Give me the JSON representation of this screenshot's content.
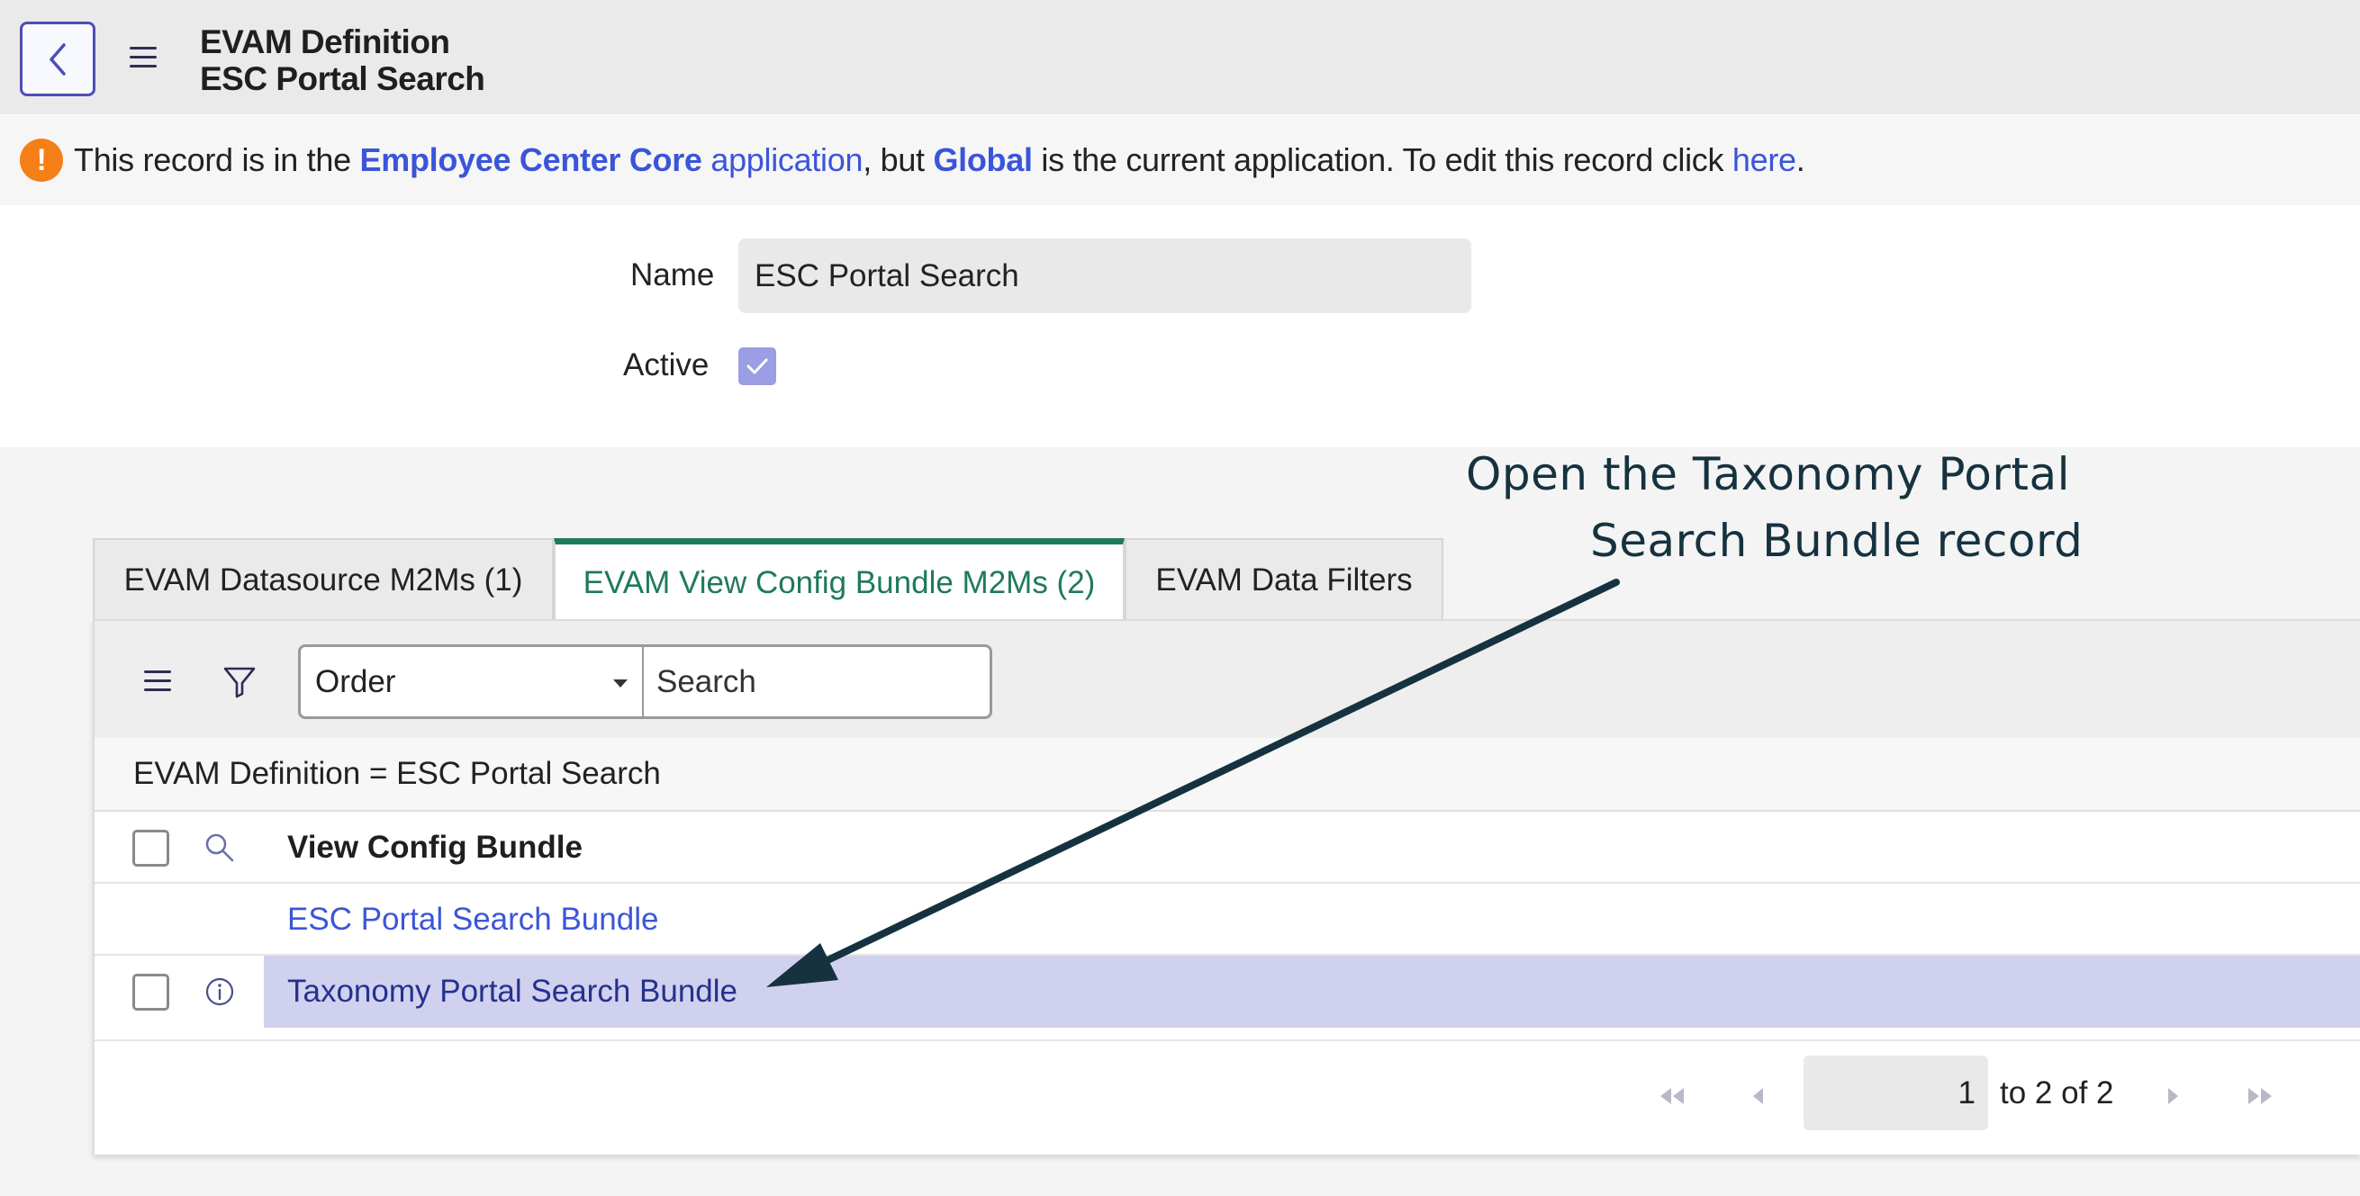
{
  "header": {
    "title_line1": "EVAM Definition",
    "title_line2": "ESC Portal Search",
    "back_icon": "chevron-left-icon",
    "menu_icon": "hamburger-icon"
  },
  "notice": {
    "icon": "exclamation-icon",
    "part1": "This record is in the",
    "app_bold": "Employee Center Core",
    "app_word": "application",
    "part2": ", but",
    "global": "Global",
    "part3": "is the current application. To edit this record click",
    "here": "here",
    "period": "."
  },
  "form": {
    "name_label": "Name",
    "name_value": "ESC Portal Search",
    "active_label": "Active",
    "active_checked": true
  },
  "tabs": [
    {
      "label": "EVAM Datasource M2Ms (1)",
      "active": false
    },
    {
      "label": "EVAM View Config Bundle M2Ms (2)",
      "active": true
    },
    {
      "label": "EVAM Data Filters",
      "active": false
    }
  ],
  "list": {
    "order_select": "Order",
    "search_placeholder": "Search",
    "breadcrumb": "EVAM Definition = ESC Portal Search",
    "column_header": "View Config Bundle",
    "rows": [
      {
        "label": "ESC Portal Search Bundle"
      },
      {
        "label": "Taxonomy Portal Search Bundle",
        "highlighted": true
      }
    ],
    "pager": {
      "page": "1",
      "range_text": "to 2 of 2"
    }
  },
  "annotation": {
    "line1": "Open the Taxonomy Portal",
    "line2": "Search Bundle record"
  },
  "colors": {
    "accent": "#1f7a58",
    "link": "#3b55d9",
    "highlight": "#d0d1ee",
    "warning": "#f57f17",
    "arrow": "#16323f"
  }
}
